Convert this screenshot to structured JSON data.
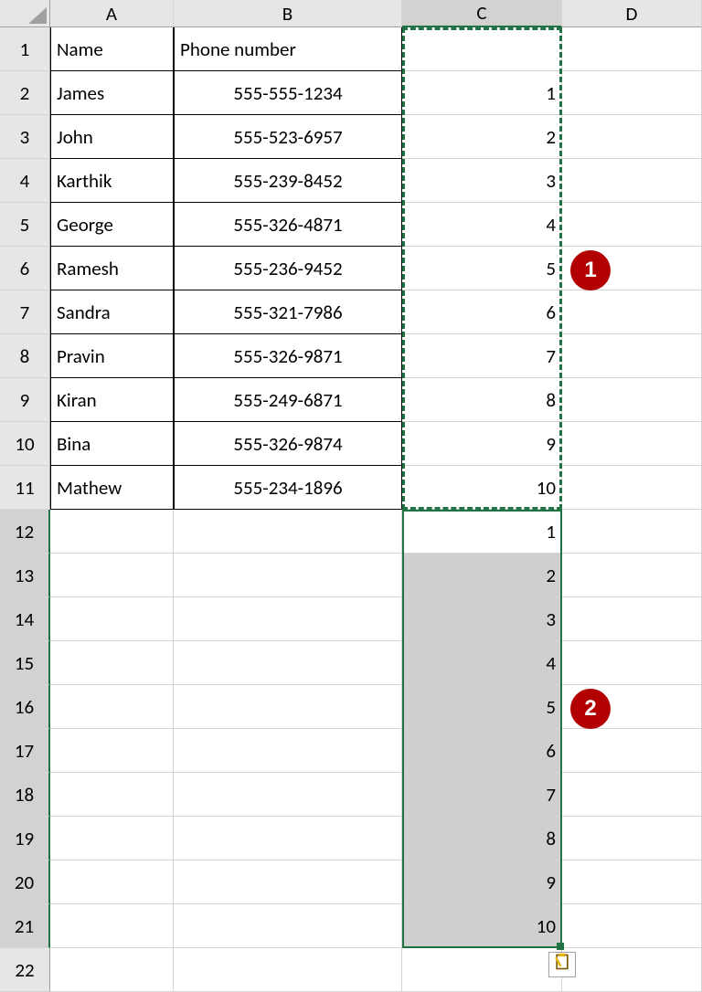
{
  "columns": {
    "A": "A",
    "B": "B",
    "C": "C",
    "D": "D"
  },
  "row_numbers": [
    "1",
    "2",
    "3",
    "4",
    "5",
    "6",
    "7",
    "8",
    "9",
    "10",
    "11",
    "12",
    "13",
    "14",
    "15",
    "16",
    "17",
    "18",
    "19",
    "20",
    "21",
    "22"
  ],
  "headers": {
    "A1": "Name",
    "B1": "Phone number"
  },
  "data_rows": [
    {
      "name": "James",
      "phone": "555-555-1234"
    },
    {
      "name": "John",
      "phone": "555-523-6957"
    },
    {
      "name": "Karthik",
      "phone": "555-239-8452"
    },
    {
      "name": "George",
      "phone": "555-326-4871"
    },
    {
      "name": "Ramesh",
      "phone": "555-236-9452"
    },
    {
      "name": "Sandra",
      "phone": "555-321-7986"
    },
    {
      "name": "Pravin",
      "phone": "555-326-9871"
    },
    {
      "name": "Kiran",
      "phone": "555-249-6871"
    },
    {
      "name": "Bina",
      "phone": "555-326-9874"
    },
    {
      "name": "Mathew",
      "phone": "555-234-1896"
    }
  ],
  "series_top": [
    "1",
    "2",
    "3",
    "4",
    "5",
    "6",
    "7",
    "8",
    "9",
    "10"
  ],
  "series_bottom": [
    "1",
    "2",
    "3",
    "4",
    "5",
    "6",
    "7",
    "8",
    "9",
    "10"
  ],
  "callouts": {
    "one": "1",
    "two": "2"
  },
  "chart_data": {
    "type": "table",
    "columns": [
      "Name",
      "Phone number"
    ],
    "rows": [
      [
        "James",
        "555-555-1234"
      ],
      [
        "John",
        "555-523-6957"
      ],
      [
        "Karthik",
        "555-239-8452"
      ],
      [
        "George",
        "555-326-4871"
      ],
      [
        "Ramesh",
        "555-236-9452"
      ],
      [
        "Sandra",
        "555-321-7986"
      ],
      [
        "Pravin",
        "555-326-9871"
      ],
      [
        "Kiran",
        "555-249-6871"
      ],
      [
        "Bina",
        "555-326-9874"
      ],
      [
        "Mathew",
        "555-234-1896"
      ]
    ],
    "helper_column_C_rows2_11": [
      1,
      2,
      3,
      4,
      5,
      6,
      7,
      8,
      9,
      10
    ],
    "helper_column_C_rows12_21": [
      1,
      2,
      3,
      4,
      5,
      6,
      7,
      8,
      9,
      10
    ]
  }
}
